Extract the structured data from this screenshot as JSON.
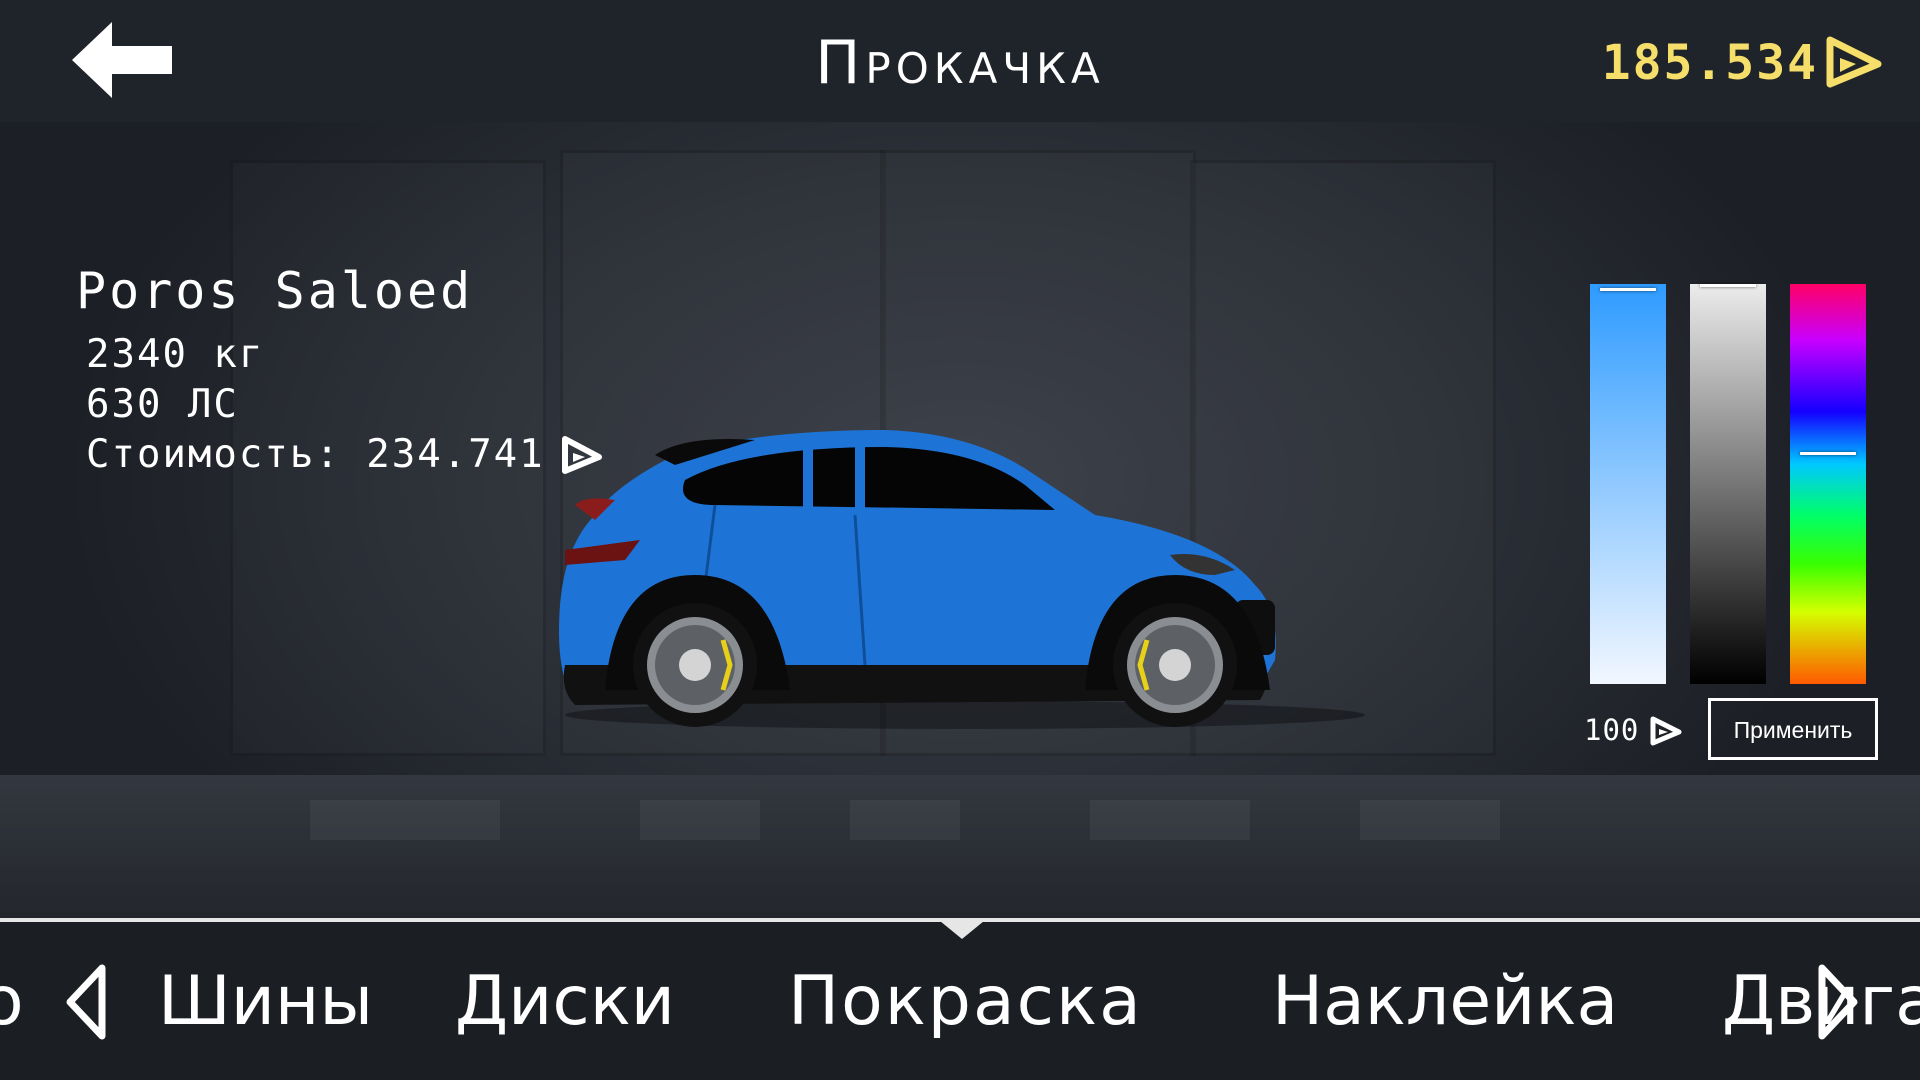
{
  "header": {
    "title": "Прокачка",
    "balance": "185.534",
    "currency_icon": "triangle-currency-icon",
    "back_icon": "arrow-left-icon"
  },
  "car": {
    "name": "Poros Saloed",
    "weight": "2340 кг",
    "power": "630 ЛС",
    "price": "Стоимость: 234.741",
    "body_color": "#1e74d6"
  },
  "paint": {
    "selected_color": "#2e9bff",
    "cost": "100",
    "apply_label": "Применить"
  },
  "tabs": [
    {
      "label": "о"
    },
    {
      "label": "Шины"
    },
    {
      "label": "Диски"
    },
    {
      "label": "Покраска",
      "active": true
    },
    {
      "label": "Наклейка"
    },
    {
      "label": "Двигатель"
    }
  ],
  "colors": {
    "accent": "#f5df6a",
    "topbar": "#1f232a",
    "tabbar": "#1b1e23"
  }
}
